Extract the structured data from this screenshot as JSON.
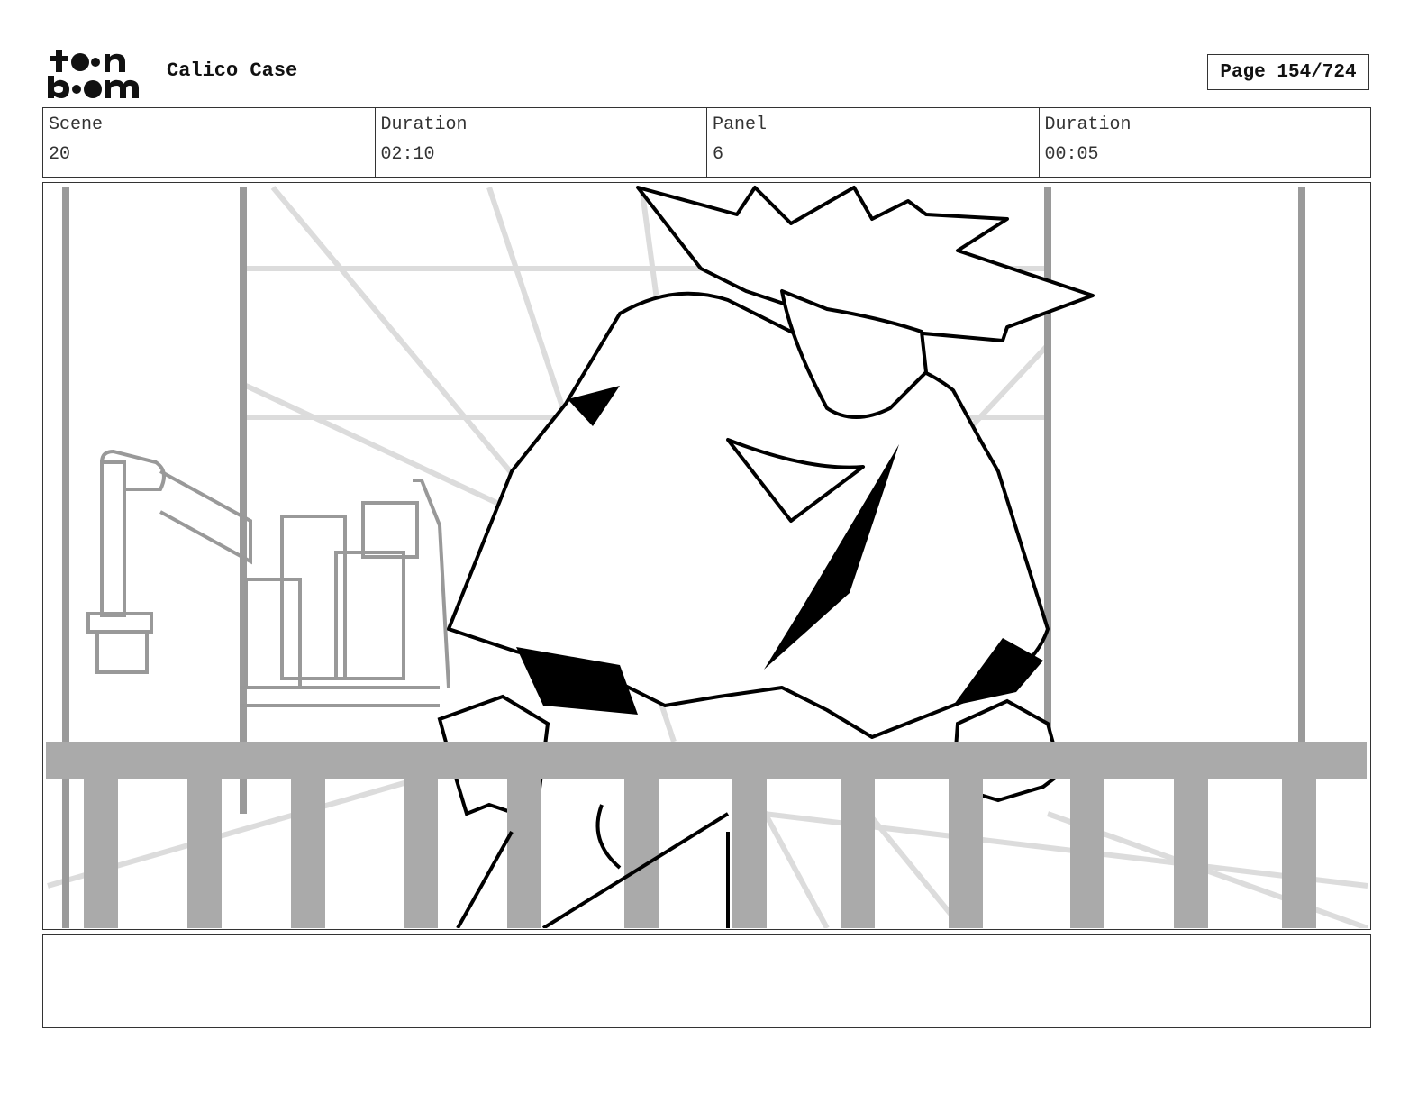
{
  "header": {
    "logo_text": "toon boom",
    "project_title": "Calico Case",
    "page_label": "Page 154/724"
  },
  "info": {
    "scene_label": "Scene",
    "scene_value": "20",
    "scene_duration_label": "Duration",
    "scene_duration_value": "02:10",
    "panel_label": "Panel",
    "panel_value": "6",
    "panel_duration_label": "Duration",
    "panel_duration_value": "00:05"
  },
  "notes": {
    "text": ""
  }
}
